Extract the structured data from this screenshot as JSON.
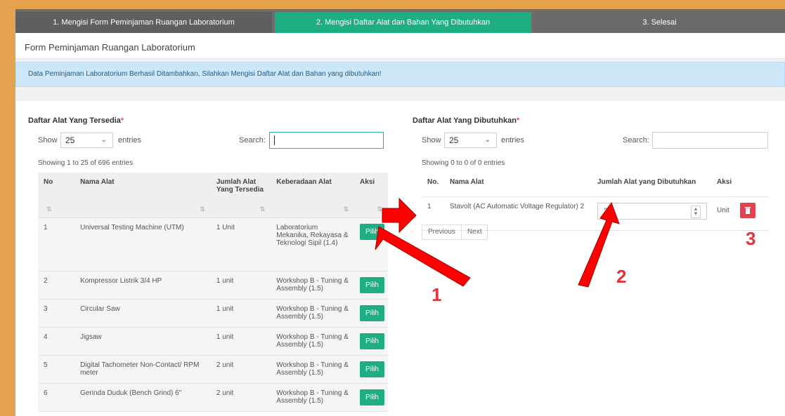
{
  "wizard": {
    "steps": [
      {
        "label": "1. Mengisi Form Peminjaman Ruangan Laboratorium",
        "state": "done"
      },
      {
        "label": "2. Mengisi Daftar Alat dan Bahan Yang Dibutuhkan",
        "state": "active"
      },
      {
        "label": "3. Selesai",
        "state": "pending"
      }
    ]
  },
  "form_title": "Form Peminjaman Ruangan Laboratorium",
  "alert": "Data Peminjaman Laboratorium Berhasil Ditambahkan, Silahkan Mengisi Daftar Alat dan Bahan yang dibutuhkan!",
  "left": {
    "title": "Daftar Alat Yang Tersedia",
    "required_mark": "*",
    "show_label": "Show",
    "entries_value": "25",
    "entries_label": "entries",
    "search_label": "Search:",
    "info": "Showing 1 to 25 of 696 entries",
    "columns": [
      "No",
      "Nama Alat",
      "Jumlah Alat Yang Tersedia",
      "Keberadaan Alat",
      "Aksi"
    ],
    "rows": [
      {
        "no": "1",
        "nama": "Universal Testing Machine (UTM)",
        "jumlah": "1 Unit",
        "lokasi": "Laboratorium Mekanika, Rekayasa & Teknologi Sipil (1.4)",
        "aksi": "Pilih"
      },
      {
        "no": "2",
        "nama": "Kompressor Listrik 3/4 HP",
        "jumlah": "1 unit",
        "lokasi": "Workshop B - Tuning & Assembly (1.5)",
        "aksi": "Pilih"
      },
      {
        "no": "3",
        "nama": "Circular Saw",
        "jumlah": "1 unit",
        "lokasi": "Workshop B - Tuning & Assembly (1.5)",
        "aksi": "Pilih"
      },
      {
        "no": "4",
        "nama": "Jigsaw",
        "jumlah": "1 unit",
        "lokasi": "Workshop B - Tuning & Assembly (1.5)",
        "aksi": "Pilih"
      },
      {
        "no": "5",
        "nama": "Digital Tachometer Non-Contact/ RPM meter",
        "jumlah": "2 unit",
        "lokasi": "Workshop B - Tuning & Assembly (1.5)",
        "aksi": "Pilih"
      },
      {
        "no": "6",
        "nama": "Gerinda Duduk (Bench Grind) 6\"",
        "jumlah": "2 unit",
        "lokasi": "Workshop B - Tuning & Assembly (1.5)",
        "aksi": "Pilih"
      }
    ]
  },
  "right": {
    "title": "Daftar Alat Yang Dibutuhkan",
    "required_mark": "*",
    "show_label": "Show",
    "entries_value": "25",
    "entries_label": "entries",
    "search_label": "Search:",
    "info": "Showing 0 to 0 of 0 entries",
    "columns": [
      "No.",
      "Nama Alat",
      "Jumlah Alat yang Dibutuhkan",
      "Aksi"
    ],
    "rows": [
      {
        "no": "1",
        "nama": "Stavolt (AC Automatic Voltage Regulator) 2",
        "jumlah": "2",
        "unit": "Unit"
      }
    ],
    "pager": {
      "prev": "Previous",
      "next": "Next"
    }
  },
  "annotations": [
    "1",
    "2",
    "3"
  ],
  "colors": {
    "accent": "#1fae84",
    "danger": "#e3434f",
    "annotation": "#e3343a",
    "frame": "#e6a34f"
  }
}
